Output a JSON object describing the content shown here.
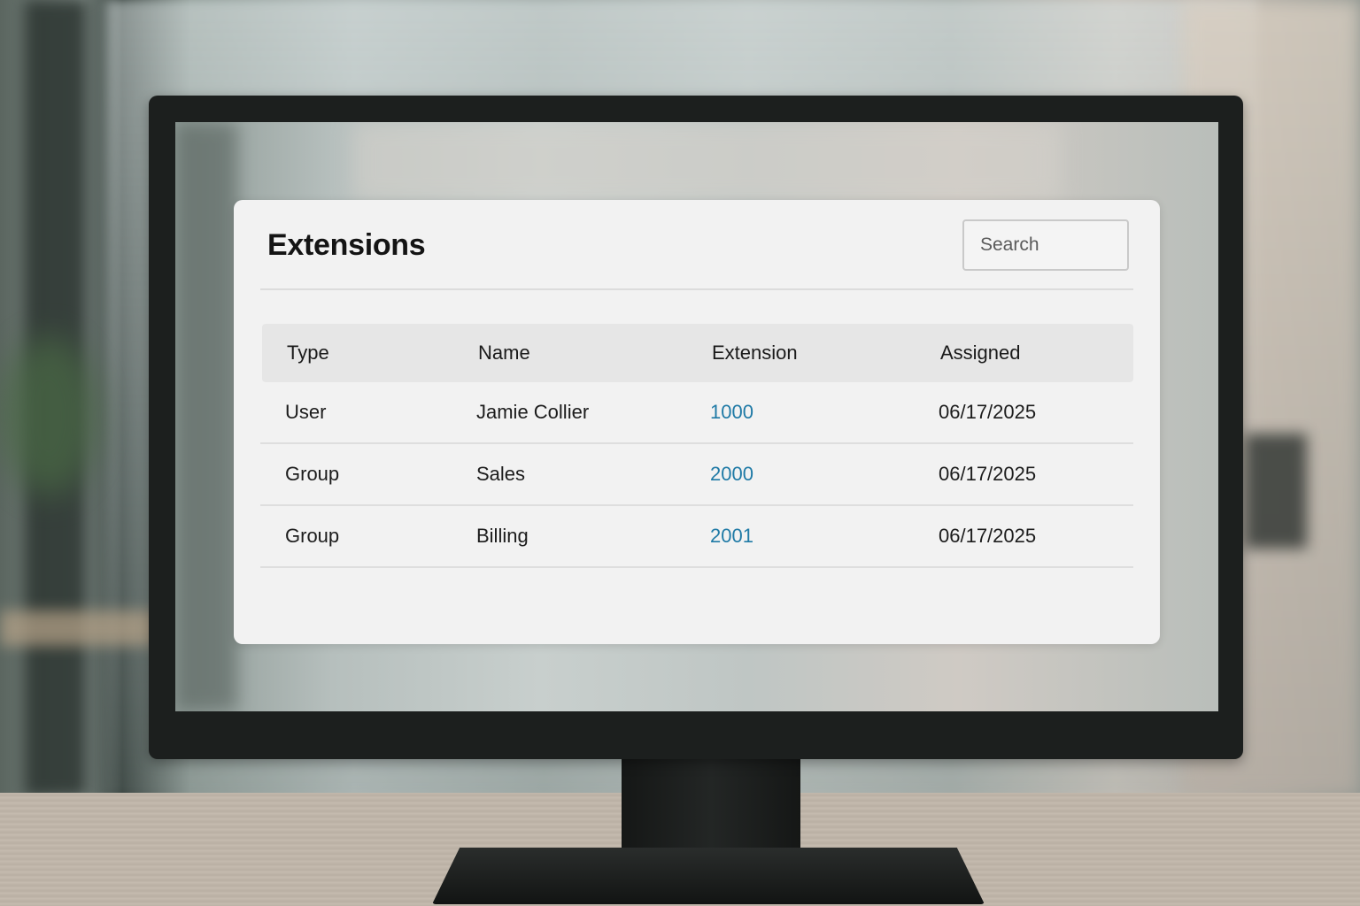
{
  "panel": {
    "title": "Extensions",
    "search_placeholder": "Search"
  },
  "table": {
    "columns": [
      "Type",
      "Name",
      "Extension",
      "Assigned"
    ],
    "rows": [
      {
        "type": "User",
        "name": "Jamie Collier",
        "extension": "1000",
        "assigned": "06/17/2025"
      },
      {
        "type": "Group",
        "name": "Sales",
        "extension": "2000",
        "assigned": "06/17/2025"
      },
      {
        "type": "Group",
        "name": "Billing",
        "extension": "2001",
        "assigned": "06/17/2025"
      }
    ]
  },
  "colors": {
    "link": "#1f7aa6",
    "panel_bg": "#f2f2f2",
    "header_bg": "#e6e6e6"
  }
}
